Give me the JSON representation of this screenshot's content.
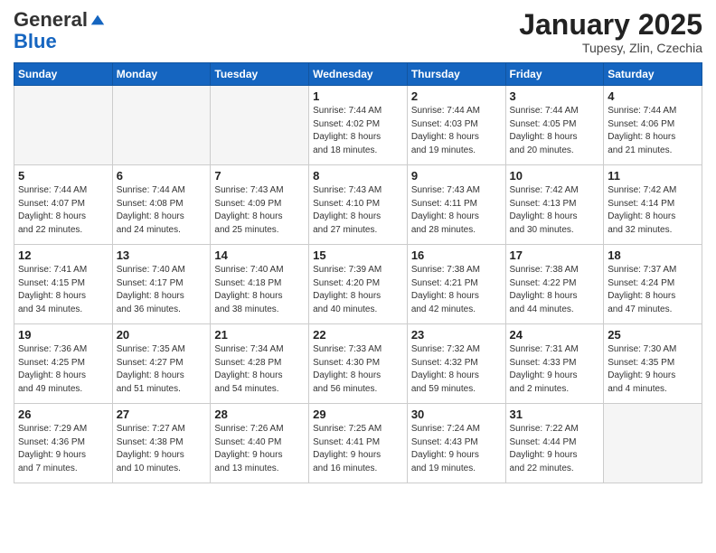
{
  "header": {
    "logo_general": "General",
    "logo_blue": "Blue",
    "month_title": "January 2025",
    "location": "Tupesy, Zlin, Czechia"
  },
  "weekdays": [
    "Sunday",
    "Monday",
    "Tuesday",
    "Wednesday",
    "Thursday",
    "Friday",
    "Saturday"
  ],
  "weeks": [
    [
      {
        "day": "",
        "info": ""
      },
      {
        "day": "",
        "info": ""
      },
      {
        "day": "",
        "info": ""
      },
      {
        "day": "1",
        "info": "Sunrise: 7:44 AM\nSunset: 4:02 PM\nDaylight: 8 hours\nand 18 minutes."
      },
      {
        "day": "2",
        "info": "Sunrise: 7:44 AM\nSunset: 4:03 PM\nDaylight: 8 hours\nand 19 minutes."
      },
      {
        "day": "3",
        "info": "Sunrise: 7:44 AM\nSunset: 4:05 PM\nDaylight: 8 hours\nand 20 minutes."
      },
      {
        "day": "4",
        "info": "Sunrise: 7:44 AM\nSunset: 4:06 PM\nDaylight: 8 hours\nand 21 minutes."
      }
    ],
    [
      {
        "day": "5",
        "info": "Sunrise: 7:44 AM\nSunset: 4:07 PM\nDaylight: 8 hours\nand 22 minutes."
      },
      {
        "day": "6",
        "info": "Sunrise: 7:44 AM\nSunset: 4:08 PM\nDaylight: 8 hours\nand 24 minutes."
      },
      {
        "day": "7",
        "info": "Sunrise: 7:43 AM\nSunset: 4:09 PM\nDaylight: 8 hours\nand 25 minutes."
      },
      {
        "day": "8",
        "info": "Sunrise: 7:43 AM\nSunset: 4:10 PM\nDaylight: 8 hours\nand 27 minutes."
      },
      {
        "day": "9",
        "info": "Sunrise: 7:43 AM\nSunset: 4:11 PM\nDaylight: 8 hours\nand 28 minutes."
      },
      {
        "day": "10",
        "info": "Sunrise: 7:42 AM\nSunset: 4:13 PM\nDaylight: 8 hours\nand 30 minutes."
      },
      {
        "day": "11",
        "info": "Sunrise: 7:42 AM\nSunset: 4:14 PM\nDaylight: 8 hours\nand 32 minutes."
      }
    ],
    [
      {
        "day": "12",
        "info": "Sunrise: 7:41 AM\nSunset: 4:15 PM\nDaylight: 8 hours\nand 34 minutes."
      },
      {
        "day": "13",
        "info": "Sunrise: 7:40 AM\nSunset: 4:17 PM\nDaylight: 8 hours\nand 36 minutes."
      },
      {
        "day": "14",
        "info": "Sunrise: 7:40 AM\nSunset: 4:18 PM\nDaylight: 8 hours\nand 38 minutes."
      },
      {
        "day": "15",
        "info": "Sunrise: 7:39 AM\nSunset: 4:20 PM\nDaylight: 8 hours\nand 40 minutes."
      },
      {
        "day": "16",
        "info": "Sunrise: 7:38 AM\nSunset: 4:21 PM\nDaylight: 8 hours\nand 42 minutes."
      },
      {
        "day": "17",
        "info": "Sunrise: 7:38 AM\nSunset: 4:22 PM\nDaylight: 8 hours\nand 44 minutes."
      },
      {
        "day": "18",
        "info": "Sunrise: 7:37 AM\nSunset: 4:24 PM\nDaylight: 8 hours\nand 47 minutes."
      }
    ],
    [
      {
        "day": "19",
        "info": "Sunrise: 7:36 AM\nSunset: 4:25 PM\nDaylight: 8 hours\nand 49 minutes."
      },
      {
        "day": "20",
        "info": "Sunrise: 7:35 AM\nSunset: 4:27 PM\nDaylight: 8 hours\nand 51 minutes."
      },
      {
        "day": "21",
        "info": "Sunrise: 7:34 AM\nSunset: 4:28 PM\nDaylight: 8 hours\nand 54 minutes."
      },
      {
        "day": "22",
        "info": "Sunrise: 7:33 AM\nSunset: 4:30 PM\nDaylight: 8 hours\nand 56 minutes."
      },
      {
        "day": "23",
        "info": "Sunrise: 7:32 AM\nSunset: 4:32 PM\nDaylight: 8 hours\nand 59 minutes."
      },
      {
        "day": "24",
        "info": "Sunrise: 7:31 AM\nSunset: 4:33 PM\nDaylight: 9 hours\nand 2 minutes."
      },
      {
        "day": "25",
        "info": "Sunrise: 7:30 AM\nSunset: 4:35 PM\nDaylight: 9 hours\nand 4 minutes."
      }
    ],
    [
      {
        "day": "26",
        "info": "Sunrise: 7:29 AM\nSunset: 4:36 PM\nDaylight: 9 hours\nand 7 minutes."
      },
      {
        "day": "27",
        "info": "Sunrise: 7:27 AM\nSunset: 4:38 PM\nDaylight: 9 hours\nand 10 minutes."
      },
      {
        "day": "28",
        "info": "Sunrise: 7:26 AM\nSunset: 4:40 PM\nDaylight: 9 hours\nand 13 minutes."
      },
      {
        "day": "29",
        "info": "Sunrise: 7:25 AM\nSunset: 4:41 PM\nDaylight: 9 hours\nand 16 minutes."
      },
      {
        "day": "30",
        "info": "Sunrise: 7:24 AM\nSunset: 4:43 PM\nDaylight: 9 hours\nand 19 minutes."
      },
      {
        "day": "31",
        "info": "Sunrise: 7:22 AM\nSunset: 4:44 PM\nDaylight: 9 hours\nand 22 minutes."
      },
      {
        "day": "",
        "info": ""
      }
    ]
  ]
}
